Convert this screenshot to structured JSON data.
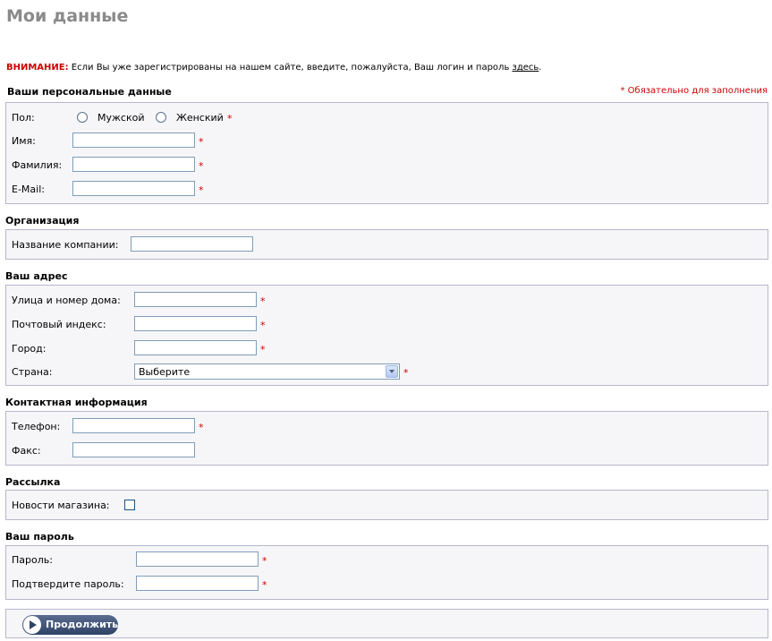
{
  "page": {
    "title": "Мои данные",
    "notice_warning": "ВНИМАНИЕ:",
    "notice_text": " Если Вы уже зарегистрированы на нашем сайте, введите, пожалуйста, Ваш логин и пароль ",
    "notice_link": "здесь",
    "notice_end": "."
  },
  "personal": {
    "title": "Ваши персональные данные",
    "required_note": "* Обязательно для заполнения",
    "gender_label": "Пол:",
    "gender_male": "Мужской",
    "gender_female": "Женский",
    "firstname_label": "Имя:",
    "lastname_label": "Фамилия:",
    "email_label": "E-Mail:",
    "star": "*"
  },
  "company": {
    "title": "Организация",
    "name_label": "Название компании:"
  },
  "address": {
    "title": "Ваш адрес",
    "street_label": "Улица и номер дома:",
    "postcode_label": "Почтовый индекс:",
    "city_label": "Город:",
    "country_label": "Страна:",
    "country_value": "Выберите"
  },
  "contact": {
    "title": "Контактная информация",
    "phone_label": "Телефон:",
    "fax_label": "Факс:"
  },
  "newsletter": {
    "title": "Рассылка",
    "news_label": "Новости магазина:"
  },
  "password": {
    "title": "Ваш пароль",
    "password_label": "Пароль:",
    "confirm_label": "Подтвердите пароль:"
  },
  "actions": {
    "continue_label": "Продолжить"
  },
  "colors": {
    "required": "#cc0000",
    "box_bg": "#f6f6f8",
    "box_border": "#b6b7cb",
    "title": "#8a8a8a"
  }
}
